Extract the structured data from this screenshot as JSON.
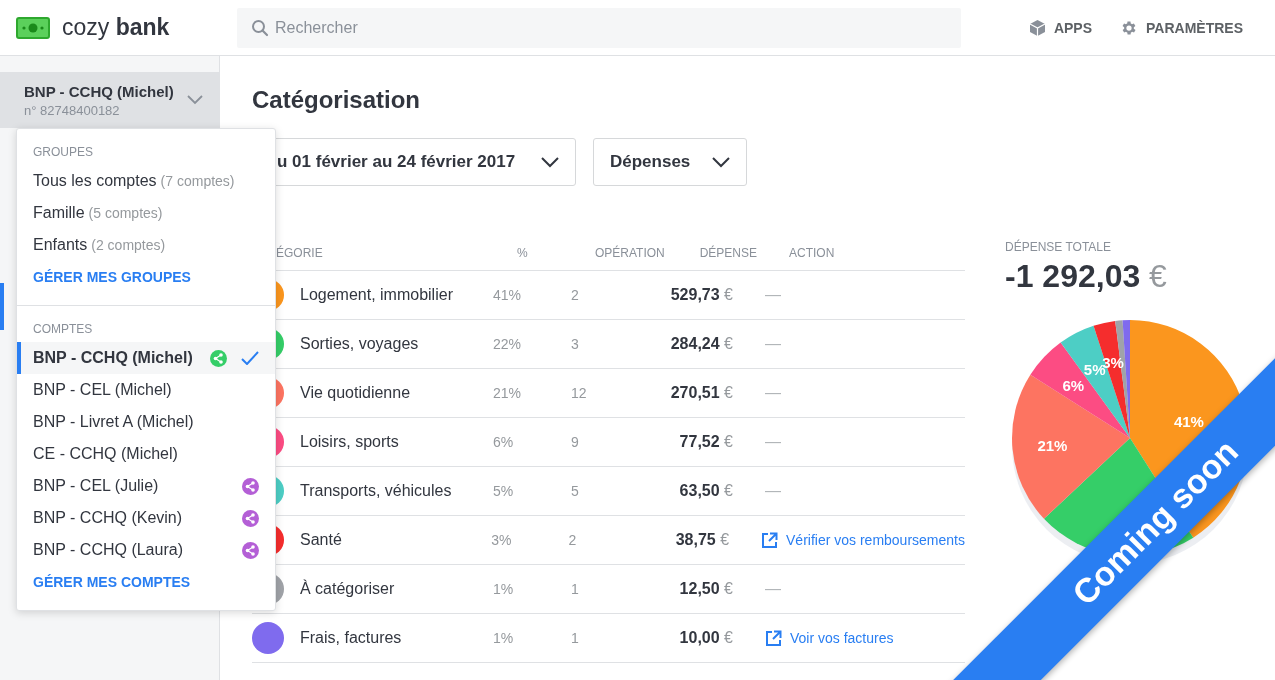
{
  "header": {
    "logo": "cozy **bank**",
    "search": {
      "placeholder": "Rechercher"
    },
    "nav": [
      {
        "kind": "apps",
        "label": "APPS"
      },
      {
        "kind": "settings",
        "label": "PARAMÈTRES"
      }
    ]
  },
  "sidebar": {
    "account": {
      "name": "BNP - CCHQ (Michel)",
      "number": "n° 82748400182"
    }
  },
  "dropdown": {
    "groups_title": "GROUPES",
    "groups": [
      {
        "name": "Tous les comptes",
        "count": "(7 comptes)"
      },
      {
        "name": "Famille",
        "count": "(5 comptes)"
      },
      {
        "name": "Enfants",
        "count": "(2 comptes)"
      }
    ],
    "groups_link": "GÉRER MES GROUPES",
    "accounts_title": "COMPTES",
    "accounts": [
      {
        "name": "BNP - CCHQ (Michel)",
        "selected": true,
        "color": "#35ce68"
      },
      {
        "name": "BNP - CEL (Michel)",
        "selected": false
      },
      {
        "name": "BNP - Livret A (Michel)",
        "selected": false
      },
      {
        "name": "CE - CCHQ (Michel)",
        "selected": false
      },
      {
        "name": "BNP - CEL (Julie)",
        "selected": false,
        "color": "#b45fd6"
      },
      {
        "name": "BNP - CCHQ (Kevin)",
        "selected": false,
        "color": "#b45fd6"
      },
      {
        "name": "BNP - CCHQ (Laura)",
        "selected": false,
        "color": "#b45fd6"
      }
    ],
    "accounts_link": "GÉRER MES COMPTES"
  },
  "main": {
    "title": "Catégorisation",
    "period_select": "u 01 février au 24 février 2017",
    "type_select": "Dépenses",
    "table": {
      "columns": [
        "ÉGORIE",
        "%",
        "OPÉRATION",
        "DÉPENSE",
        "ACTION"
      ],
      "rows": [
        {
          "category": "Logement, immobilier",
          "percent": "41%",
          "operations": "2",
          "amount": "529,73",
          "currency": "€",
          "color": "#fb961e",
          "action": {
            "kind": "none",
            "text": "—"
          }
        },
        {
          "category": "Sorties, voyages",
          "percent": "22%",
          "operations": "3",
          "amount": "284,24",
          "currency": "€",
          "color": "#35ce68",
          "action": {
            "kind": "none",
            "text": "—"
          }
        },
        {
          "category": "Vie quotidienne",
          "percent": "21%",
          "operations": "12",
          "amount": "270,51",
          "currency": "€",
          "color": "#fd7461",
          "action": {
            "kind": "none",
            "text": "—"
          }
        },
        {
          "category": "Loisirs, sports",
          "percent": "6%",
          "operations": "9",
          "amount": "77,52",
          "currency": "€",
          "color": "#fc4c83",
          "action": {
            "kind": "none",
            "text": "—"
          }
        },
        {
          "category": "Transports, véhicules",
          "percent": "5%",
          "operations": "5",
          "amount": "63,50",
          "currency": "€",
          "color": "#4dcec5",
          "action": {
            "kind": "none",
            "text": "—"
          }
        },
        {
          "category": "Santé",
          "percent": "3%",
          "operations": "2",
          "amount": "38,75",
          "currency": "€",
          "color": "#f52d2d",
          "action": {
            "kind": "link",
            "text": "Vérifier vos remboursements"
          }
        },
        {
          "category": "À catégoriser",
          "percent": "1%",
          "operations": "1",
          "amount": "12,50",
          "currency": "€",
          "color": "#a0a3a8",
          "action": {
            "kind": "none",
            "text": "—"
          }
        },
        {
          "category": "Frais, factures",
          "percent": "1%",
          "operations": "1",
          "amount": "10,00",
          "currency": "€",
          "color": "#7f6bee",
          "action": {
            "kind": "link",
            "text": "Voir vos factures"
          }
        }
      ]
    },
    "total": {
      "label": "DÉPENSE TOTALE",
      "amount": "-1 292,03",
      "currency": "€"
    },
    "chart_data": {
      "type": "pie",
      "values": [
        41,
        22,
        21,
        6,
        5,
        3,
        1,
        1
      ],
      "colors": [
        "#fb961e",
        "#35ce68",
        "#fd7461",
        "#fc4c83",
        "#4dcec5",
        "#f52d2d",
        "#a0a3a8",
        "#7f6bee"
      ],
      "value_labels": [
        "41%",
        null,
        "21%",
        "6%",
        "5%",
        "3%",
        null,
        null
      ]
    }
  },
  "ribbon": {
    "text": "Coming soon"
  }
}
